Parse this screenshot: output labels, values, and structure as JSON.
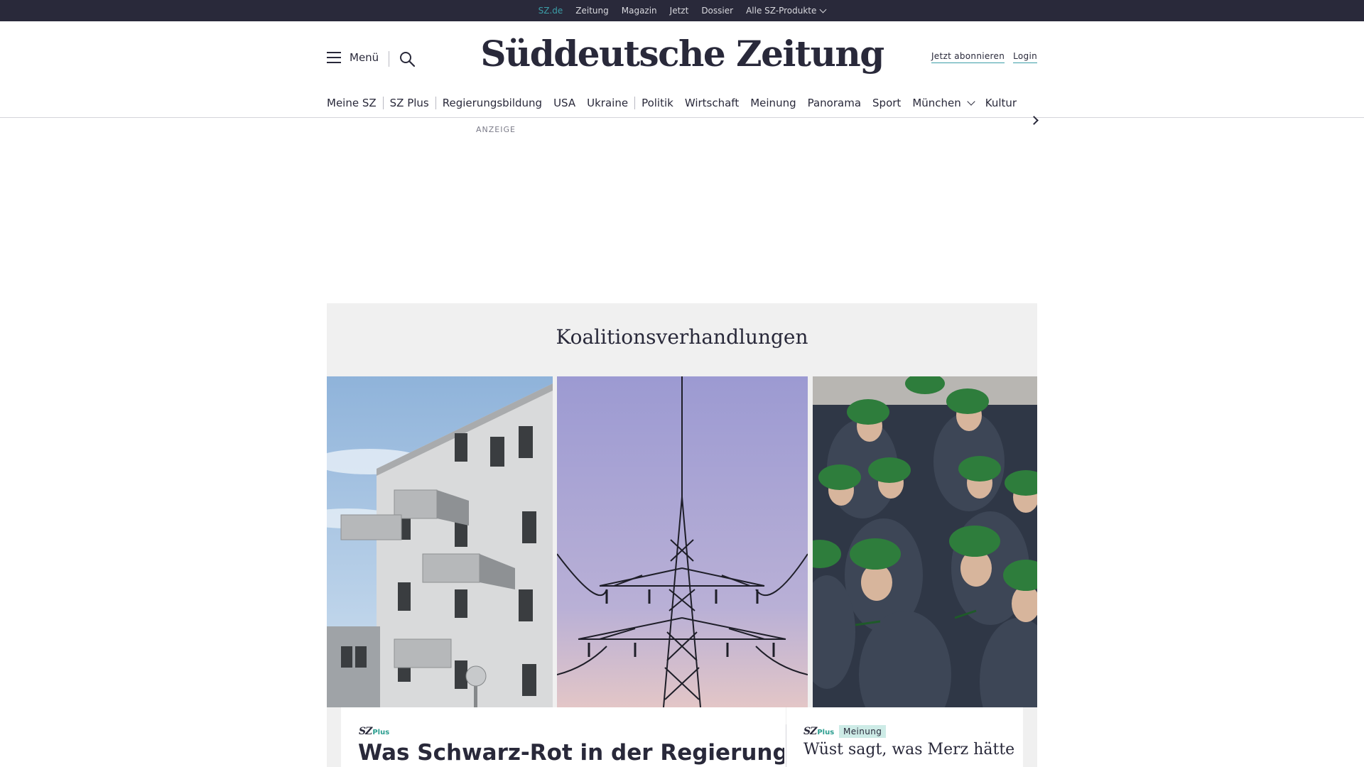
{
  "topbar": {
    "links": [
      {
        "label": "SZ.de",
        "active": true
      },
      {
        "label": "Zeitung",
        "active": false
      },
      {
        "label": "Magazin",
        "active": false
      },
      {
        "label": "Jetzt",
        "active": false
      },
      {
        "label": "Dossier",
        "active": false
      },
      {
        "label": "Alle SZ-Produkte",
        "active": false,
        "dropdown": true
      }
    ]
  },
  "header": {
    "menu_label": "Menü",
    "logo_text": "Süddeutsche Zeitung",
    "subscribe_label": "Jetzt abonnieren",
    "login_label": "Login"
  },
  "nav": {
    "items": [
      {
        "label": "Meine SZ"
      },
      {
        "label": "SZ Plus"
      },
      {
        "label": "Regierungsbildung"
      },
      {
        "label": "USA"
      },
      {
        "label": "Ukraine"
      },
      {
        "label": "Politik"
      },
      {
        "label": "Wirtschaft"
      },
      {
        "label": "Meinung"
      },
      {
        "label": "Panorama"
      },
      {
        "label": "Sport"
      },
      {
        "label": "München",
        "dropdown": true
      },
      {
        "label": "Kultur"
      }
    ]
  },
  "ad": {
    "label": "ANZEIGE"
  },
  "section": {
    "title": "Koalitionsverhandlungen",
    "cards": [
      {
        "brand": "SZ",
        "brand_plus": "Plus",
        "headline": "Was Schwarz-Rot in der Regierung"
      },
      {
        "brand": "SZ",
        "brand_plus": "Plus",
        "badge": "Meinung",
        "headline": "Wüst sagt, was Merz hätte"
      }
    ]
  },
  "colors": {
    "dark": "#29293a",
    "accent": "#3c9ea8",
    "plus_green": "#2a9d8f",
    "section_bg": "#f0f0f0",
    "badge_bg": "#cdebe6"
  },
  "icons": {
    "menu": "hamburger-icon",
    "search": "search-icon",
    "nav_next": "chevron-right-icon",
    "dropdown": "chevron-down-icon"
  }
}
